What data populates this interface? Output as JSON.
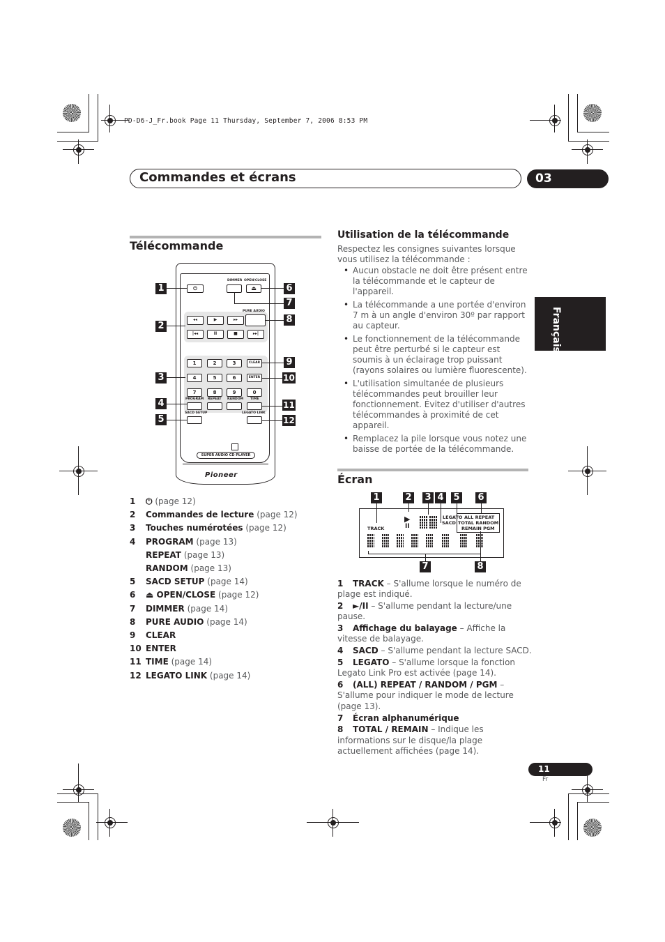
{
  "print_header": "PD-D6-J_Fr.book  Page 11  Thursday, September 7, 2006  8:53 PM",
  "chapter": {
    "title": "Commandes et écrans",
    "number": "03"
  },
  "language_tab": "Français",
  "remote_section": {
    "title": "Télécommande",
    "remote_labels": {
      "dimmer": "DIMMER",
      "open_close": "OPEN/CLOSE",
      "pure_audio": "PURE AUDIO",
      "power_glyph": "⏻",
      "eject_glyph": "⏏",
      "rew": "◂◂",
      "play": "▶",
      "ff": "▸▸",
      "prev": "|◂◂",
      "pause": "II",
      "stop": "■",
      "next": "▸▸|",
      "digits": [
        "1",
        "2",
        "3",
        "4",
        "5",
        "6",
        "7",
        "8",
        "9",
        "0"
      ],
      "clear": "CLEAR",
      "enter": "ENTER",
      "program": "PROGRAM",
      "repeat": "REPEAT",
      "random": "RANDOM",
      "time": "TIME",
      "sacd_setup": "SACD SETUP",
      "legato_link": "LEGATO LINK",
      "sacd_badge": "SACD",
      "model": "SUPER AUDIO CD PLAYER",
      "brand": "Pioneer"
    },
    "callouts": [
      "1",
      "2",
      "3",
      "4",
      "5",
      "6",
      "7",
      "8",
      "9",
      "10",
      "11",
      "12"
    ],
    "key_list": [
      {
        "num": "1",
        "name": "⏻",
        "page": "(page 12)"
      },
      {
        "num": "2",
        "name": "Commandes de lecture",
        "page": "(page 12)"
      },
      {
        "num": "3",
        "name": "Touches numérotées",
        "page": "(page 12)"
      },
      {
        "num": "4",
        "name": "PROGRAM",
        "page": "(page 13)"
      },
      {
        "num": "",
        "name": "REPEAT",
        "page": "(page 13)"
      },
      {
        "num": "",
        "name": "RANDOM",
        "page": "(page 13)"
      },
      {
        "num": "5",
        "name": "SACD SETUP",
        "page": "(page 14)"
      },
      {
        "num": "6",
        "name": "⏏ OPEN/CLOSE",
        "page": "(page 12)"
      },
      {
        "num": "7",
        "name": "DIMMER",
        "page": "(page 14)"
      },
      {
        "num": "8",
        "name": "PURE AUDIO",
        "page": "(page 14)"
      },
      {
        "num": "9",
        "name": "CLEAR",
        "page": ""
      },
      {
        "num": "10",
        "name": "ENTER",
        "page": ""
      },
      {
        "num": "11",
        "name": "TIME",
        "page": "(page 14)"
      },
      {
        "num": "12",
        "name": "LEGATO LINK",
        "page": "(page 14)"
      }
    ]
  },
  "usage_section": {
    "title": "Utilisation de la télécommande",
    "intro": "Respectez les consignes suivantes lorsque vous utilisez la télécommande :",
    "bullets": [
      "Aucun obstacle ne doit être présent entre la télécommande et le capteur de l'appareil.",
      "La télécommande a une portée d'environ 7 m à un angle d'environ 30º par rapport au capteur.",
      "Le fonctionnement de la télécommande peut être perturbé si le capteur est soumis à un éclairage trop puissant (rayons solaires ou lumière fluorescente).",
      "L'utilisation simultanée de plusieurs télécommandes peut brouiller leur fonctionnement. Évitez d'utiliser d'autres télécommandes à proximité de cet appareil.",
      "Remplacez la pile lorsque vous notez une baisse de portée de la télécommande."
    ]
  },
  "display_section": {
    "title": "Écran",
    "display_labels": {
      "track": "TRACK",
      "play": "▶",
      "pause": "II",
      "legato": "LEGATO",
      "sacd": "SACD",
      "all_repeat": "ALL  REPEAT",
      "total_random": "TOTAL RANDOM",
      "remain_pgm": "REMAIN  PGM"
    },
    "callouts": [
      "1",
      "2",
      "3",
      "4",
      "5",
      "6",
      "7",
      "8"
    ],
    "descriptions": [
      {
        "num": "1",
        "name": "TRACK",
        "text": " – S'allume lorsque le numéro de plage est indiqué."
      },
      {
        "num": "2",
        "name": "►/II",
        "text": " – S'allume pendant la lecture/une pause."
      },
      {
        "num": "3",
        "name": "Affichage du balayage",
        "text": " – Affiche la vitesse de balayage."
      },
      {
        "num": "4",
        "name": "SACD",
        "text": " – S'allume pendant la lecture SACD."
      },
      {
        "num": "5",
        "name": "LEGATO",
        "text": " – S'allume lorsque la fonction Legato Link Pro est activée (page 14)."
      },
      {
        "num": "6",
        "name": "(ALL) REPEAT / RANDOM / PGM",
        "text": " – S'allume pour indiquer le mode de lecture (page 13)."
      },
      {
        "num": "7",
        "name": "Écran alphanumérique",
        "text": ""
      },
      {
        "num": "8",
        "name": "TOTAL / REMAIN",
        "text": " – Indique les informations sur le disque/la plage actuellement affichées (page 14)."
      }
    ]
  },
  "footer": {
    "page_number": "11",
    "lang_code": "Fr"
  }
}
